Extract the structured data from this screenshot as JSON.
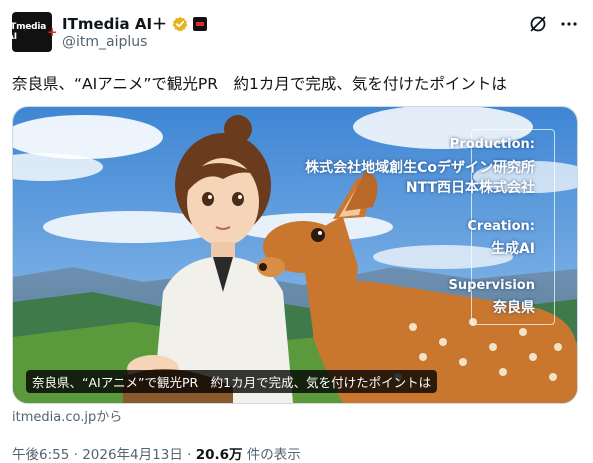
{
  "author": {
    "display_name": "ITmedia AI＋",
    "handle": "@itm_aiplus",
    "avatar_text": "ITmedia AI",
    "avatar_plus": "+"
  },
  "tweet": {
    "text": "奈良県、“AIアニメ”で観光PR　約1カ月で完成、気を付けたポイントは"
  },
  "card": {
    "production_label": "Production:",
    "production_line1": "株式会社地域創生Coデザイン研究所",
    "production_line2": "NTT西日本株式会社",
    "creation_label": "Creation:",
    "creation_value": "生成AI",
    "supervision_label": "Supervision",
    "supervision_value": "奈良県",
    "caption": "奈良県、“AIアニメ”で観光PR　約1カ月で完成、気を付けたポイントは",
    "source": "itmedia.co.jpから"
  },
  "meta": {
    "time": "午後6:55",
    "separator": " · ",
    "date": "2026年4月13日",
    "views_count": "20.6万",
    "views_label": " 件の表示"
  },
  "colors": {
    "verified": "#e8b21c",
    "text_secondary": "#536471",
    "sky": "#4f8fd6"
  }
}
